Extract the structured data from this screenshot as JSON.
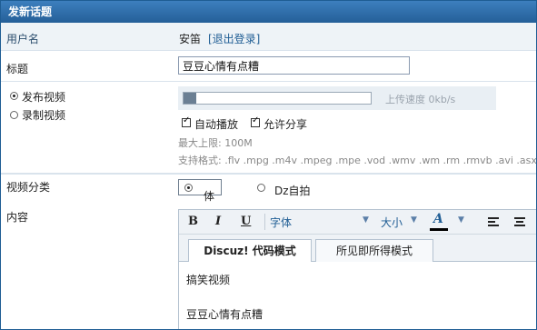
{
  "window": {
    "title": "发新话题"
  },
  "user": {
    "label": "用户名",
    "name": "安笛",
    "logout": "[退出登录]"
  },
  "title_field": {
    "label": "标题",
    "value": "豆豆心情有点糟"
  },
  "video": {
    "publish_label": "发布视频",
    "record_label": "录制视频",
    "selected": "publish",
    "upload_progress": 0.07,
    "speed_text": "上传速度 0kb/s",
    "autoplay_label": "自动播放",
    "autoplay_checked": true,
    "share_label": "允许分享",
    "share_checked": true,
    "max_limit": "最大上限: 100M",
    "formats": "支持格式: .flv .mpg .m4v .mpeg .mpe .vod .wmv .wm .rm .rmvb .avi .asx .ra"
  },
  "category": {
    "label": "视频分类",
    "options": [
      "体育",
      "Dz自拍"
    ],
    "selected": "体育"
  },
  "content": {
    "label": "内容",
    "toolbar": {
      "bold": "B",
      "italic": "I",
      "underline": "U",
      "font": "字体",
      "size": "大小",
      "color": "A",
      "color_bar": "#000000"
    },
    "tabs": [
      "Discuz! 代码模式",
      "所见即所得模式"
    ],
    "active_tab": "Discuz! 代码模式",
    "body_lines": [
      "搞笑视频",
      "豆豆心情有点糟"
    ]
  },
  "colors": {
    "titlebar": "#2f6fad",
    "label_row_bg": "#eef3f7",
    "link": "#1f5d94"
  }
}
